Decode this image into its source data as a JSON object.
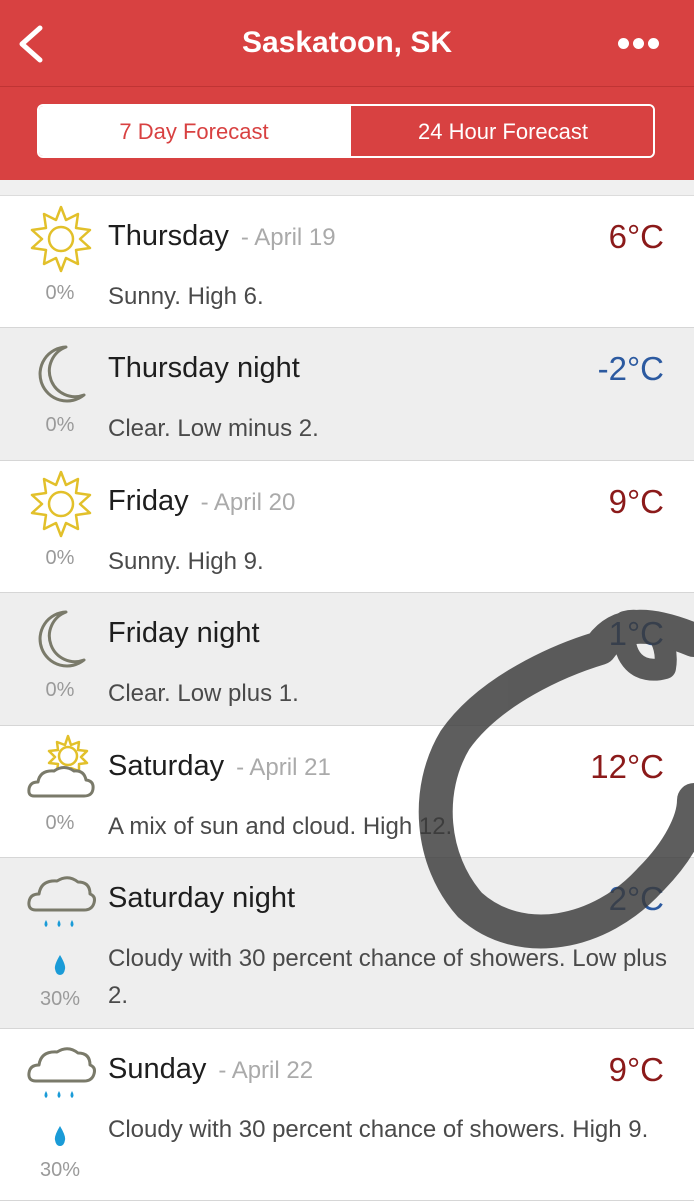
{
  "header": {
    "title": "Saskatoon, SK",
    "back_icon": "chevron-left-icon",
    "more_icon": "ellipsis-icon",
    "background_color": "#d84141"
  },
  "tabs": [
    {
      "label": "7 Day Forecast",
      "active": true
    },
    {
      "label": "24 Hour Forecast",
      "active": false
    }
  ],
  "forecast": [
    {
      "period": "Thursday",
      "date": "- April 19",
      "temp": "6°C",
      "pop": "0%",
      "desc": "Sunny. High 6.",
      "icon": "sun-icon"
    },
    {
      "period": "Thursday night",
      "date": "",
      "temp": "-2°C",
      "pop": "0%",
      "desc": "Clear. Low minus 2.",
      "icon": "moon-icon"
    },
    {
      "period": "Friday",
      "date": "- April 20",
      "temp": "9°C",
      "pop": "0%",
      "desc": "Sunny. High 9.",
      "icon": "sun-icon"
    },
    {
      "period": "Friday night",
      "date": "",
      "temp": "1°C",
      "pop": "0%",
      "desc": "Clear. Low plus 1.",
      "icon": "moon-icon"
    },
    {
      "period": "Saturday",
      "date": "- April 21",
      "temp": "12°C",
      "pop": "0%",
      "desc": "A mix of sun and cloud. High 12.",
      "icon": "sun-cloud-icon"
    },
    {
      "period": "Saturday night",
      "date": "",
      "temp": "2°C",
      "pop": "30%",
      "desc": "Cloudy with 30 percent chance of showers. Low plus 2.",
      "icon": "rain-cloud-icon"
    },
    {
      "period": "Sunday",
      "date": "- April 22",
      "temp": "9°C",
      "pop": "30%",
      "desc": "Cloudy with 30 percent chance of showers. High 9.",
      "icon": "rain-cloud-icon"
    }
  ],
  "colors": {
    "high_temp": "#8b1a1a",
    "low_temp": "#2c5aa0",
    "icon_sun": "#e2c02a",
    "icon_moon": "#7a7a6a",
    "drop": "#1a9bd7"
  }
}
